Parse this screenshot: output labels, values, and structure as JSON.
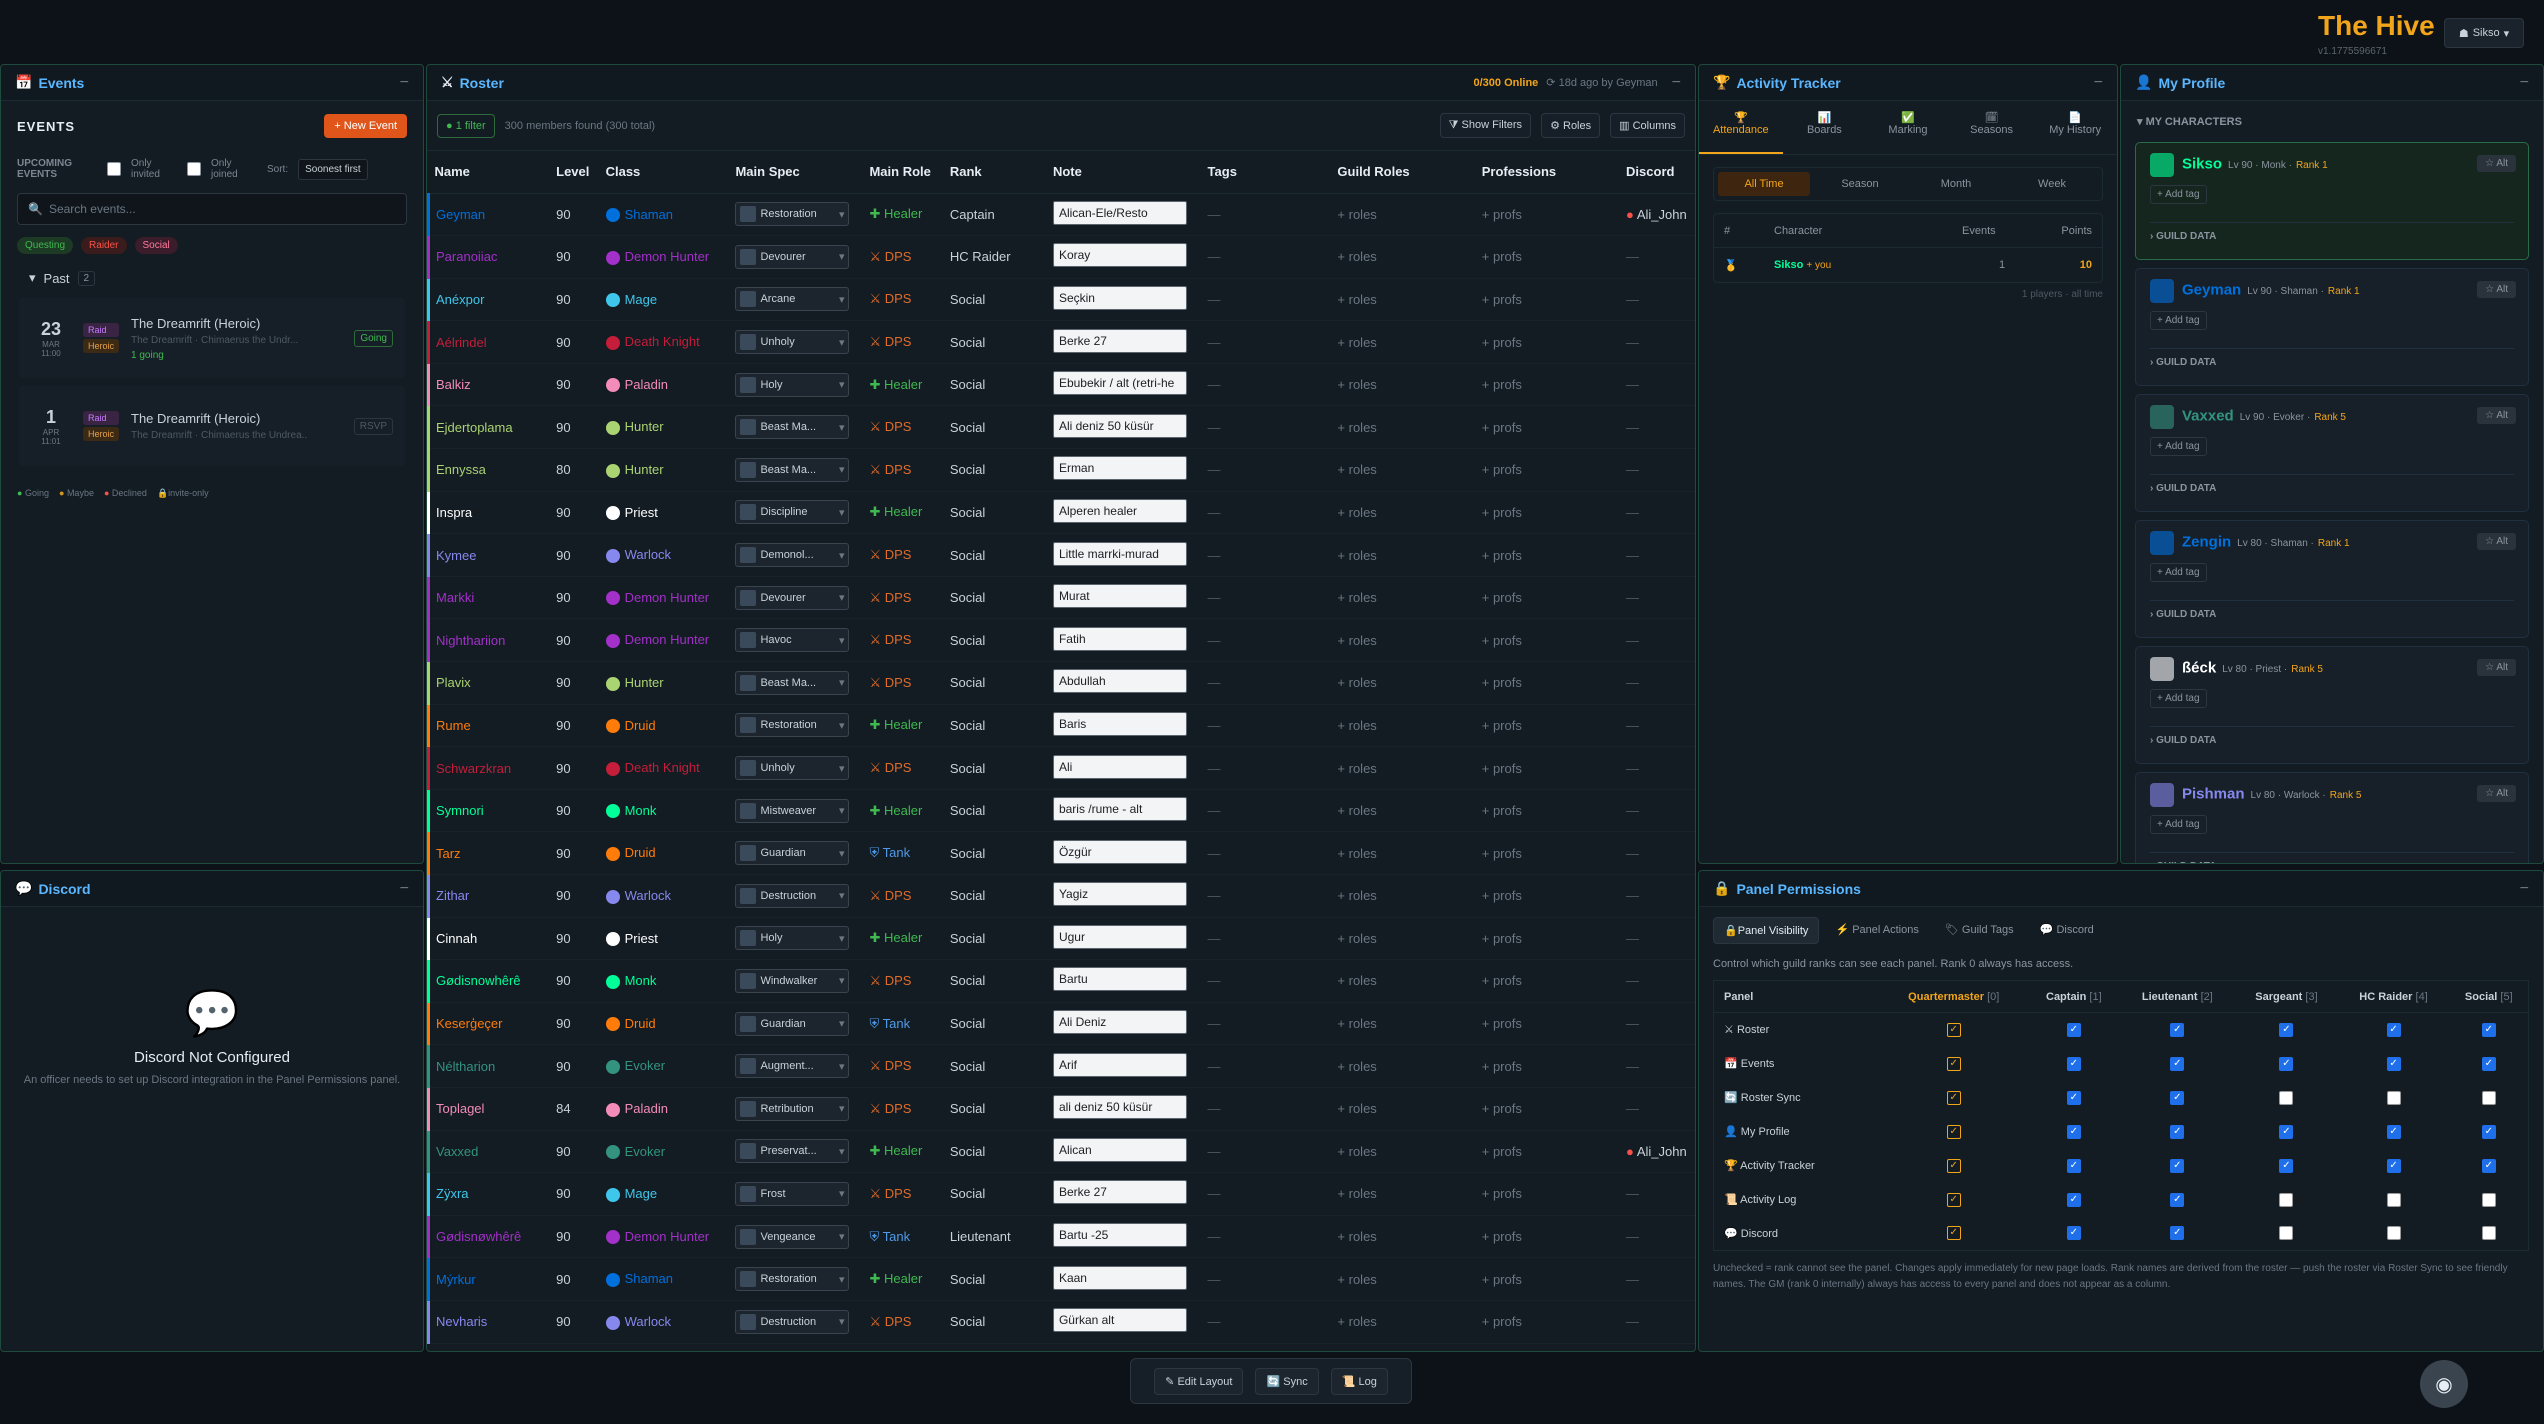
{
  "header": {
    "brand": "The Hive",
    "version": "v1.1775596671",
    "user": "Sikso"
  },
  "events": {
    "panel_title": "Events",
    "heading": "EVENTS",
    "new_btn": "+ New Event",
    "upcoming": "UPCOMING EVENTS",
    "only_invited": "Only invited",
    "only_joined": "Only joined",
    "sort_label": "Sort:",
    "sort_value": "Soonest first",
    "search_placeholder": "Search events...",
    "tags": [
      "Questing",
      "Raider",
      "Social"
    ],
    "past_label": "Past",
    "past_count": "2",
    "items": [
      {
        "day": "23",
        "month": "MAR",
        "time": "11:00",
        "type": "Raid",
        "diff": "Heroic",
        "title": "The Dreamrift (Heroic)",
        "desc": "The Dreamrift · Chimaerus the Undr...",
        "status": "Going",
        "going": "1 going"
      },
      {
        "day": "1",
        "month": "APR",
        "time": "11:01",
        "type": "Raid",
        "diff": "Heroic",
        "title": "The Dreamrift (Heroic)",
        "desc": "The Dreamrift · Chimaerus the Undrea..",
        "status": "RSVP"
      }
    ],
    "legend": [
      "Going",
      "Maybe",
      "Declined",
      "invite-only"
    ]
  },
  "discord": {
    "panel_title": "Discord",
    "title": "Discord Not Configured",
    "body": "An officer needs to set up Discord integration in the Panel Permissions panel."
  },
  "roster": {
    "panel_title": "Roster",
    "online": "0/300 Online",
    "synced": "18d ago by Geyman",
    "filter_badge": "1 filter",
    "found": "300 members found (300 total)",
    "show_filters": "Show Filters",
    "roles_btn": "Roles",
    "columns_btn": "Columns",
    "columns": [
      "Name",
      "Level",
      "Class",
      "Main Spec",
      "Main Role",
      "Rank",
      "Note",
      "Tags",
      "Guild Roles",
      "Professions",
      "Discord"
    ],
    "roles_placeholder": "+ roles",
    "profs_placeholder": "+ profs",
    "dash": "—",
    "rows": [
      {
        "name": "Geyman",
        "level": "90",
        "cls": "Shaman",
        "color": "#0070dd",
        "spec": "Restoration",
        "role": "Healer",
        "rank": "Captain",
        "note": "Alican-Ele/Resto",
        "discord": "Ali_John"
      },
      {
        "name": "Paranoiiac",
        "level": "90",
        "cls": "Demon Hunter",
        "color": "#a330c9",
        "spec": "Devourer",
        "role": "DPS",
        "rank": "HC Raider",
        "note": "Koray",
        "discord": ""
      },
      {
        "name": "Anéxpor",
        "level": "90",
        "cls": "Mage",
        "color": "#3fc7eb",
        "spec": "Arcane",
        "role": "DPS",
        "rank": "Social",
        "note": "Seçkin",
        "discord": ""
      },
      {
        "name": "Aélrindel",
        "level": "90",
        "cls": "Death Knight",
        "color": "#c41e3a",
        "spec": "Unholy",
        "role": "DPS",
        "rank": "Social",
        "note": "Berke 27",
        "discord": ""
      },
      {
        "name": "Balkiz",
        "level": "90",
        "cls": "Paladin",
        "color": "#f48cba",
        "spec": "Holy",
        "role": "Healer",
        "rank": "Social",
        "note": "Ebubekir / alt (retri-he",
        "discord": ""
      },
      {
        "name": "Ejdertoplama",
        "level": "90",
        "cls": "Hunter",
        "color": "#aad372",
        "spec": "Beast Ma...",
        "role": "DPS",
        "rank": "Social",
        "note": "Ali deniz 50 küsür",
        "discord": ""
      },
      {
        "name": "Ennyssa",
        "level": "80",
        "cls": "Hunter",
        "color": "#aad372",
        "spec": "Beast Ma...",
        "role": "DPS",
        "rank": "Social",
        "note": "Erman",
        "discord": ""
      },
      {
        "name": "Inspra",
        "level": "90",
        "cls": "Priest",
        "color": "#ffffff",
        "spec": "Discipline",
        "role": "Healer",
        "rank": "Social",
        "note": "Alperen healer",
        "discord": ""
      },
      {
        "name": "Kymee",
        "level": "90",
        "cls": "Warlock",
        "color": "#8788ee",
        "spec": "Demonol...",
        "role": "DPS",
        "rank": "Social",
        "note": "Little marrki-murad",
        "discord": ""
      },
      {
        "name": "Markki",
        "level": "90",
        "cls": "Demon Hunter",
        "color": "#a330c9",
        "spec": "Devourer",
        "role": "DPS",
        "rank": "Social",
        "note": "Murat",
        "discord": ""
      },
      {
        "name": "Nighthariion",
        "level": "90",
        "cls": "Demon Hunter",
        "color": "#a330c9",
        "spec": "Havoc",
        "role": "DPS",
        "rank": "Social",
        "note": "Fatih",
        "discord": ""
      },
      {
        "name": "Plavix",
        "level": "90",
        "cls": "Hunter",
        "color": "#aad372",
        "spec": "Beast Ma...",
        "role": "DPS",
        "rank": "Social",
        "note": "Abdullah",
        "discord": ""
      },
      {
        "name": "Rume",
        "level": "90",
        "cls": "Druid",
        "color": "#ff7c0a",
        "spec": "Restoration",
        "role": "Healer",
        "rank": "Social",
        "note": "Baris",
        "discord": ""
      },
      {
        "name": "Schwarzkran",
        "level": "90",
        "cls": "Death Knight",
        "color": "#c41e3a",
        "spec": "Unholy",
        "role": "DPS",
        "rank": "Social",
        "note": "Ali",
        "discord": ""
      },
      {
        "name": "Symnori",
        "level": "90",
        "cls": "Monk",
        "color": "#00ff98",
        "spec": "Mistweaver",
        "role": "Healer",
        "rank": "Social",
        "note": "baris /rume - alt",
        "discord": ""
      },
      {
        "name": "Tarz",
        "level": "90",
        "cls": "Druid",
        "color": "#ff7c0a",
        "spec": "Guardian",
        "role": "Tank",
        "rank": "Social",
        "note": "Özgür",
        "discord": ""
      },
      {
        "name": "Zithar",
        "level": "90",
        "cls": "Warlock",
        "color": "#8788ee",
        "spec": "Destruction",
        "role": "DPS",
        "rank": "Social",
        "note": "Yagiz",
        "discord": ""
      },
      {
        "name": "Cinnah",
        "level": "90",
        "cls": "Priest",
        "color": "#ffffff",
        "spec": "Holy",
        "role": "Healer",
        "rank": "Social",
        "note": "Ugur",
        "discord": ""
      },
      {
        "name": "Gødisnowhêrê",
        "level": "90",
        "cls": "Monk",
        "color": "#00ff98",
        "spec": "Windwalker",
        "role": "DPS",
        "rank": "Social",
        "note": "Bartu",
        "discord": ""
      },
      {
        "name": "Keserģeçer",
        "level": "90",
        "cls": "Druid",
        "color": "#ff7c0a",
        "spec": "Guardian",
        "role": "Tank",
        "rank": "Social",
        "note": "Ali Deniz",
        "discord": ""
      },
      {
        "name": "Néltharion",
        "level": "90",
        "cls": "Evoker",
        "color": "#33937f",
        "spec": "Augment...",
        "role": "DPS",
        "rank": "Social",
        "note": "Arif",
        "discord": ""
      },
      {
        "name": "Toplagel",
        "level": "84",
        "cls": "Paladin",
        "color": "#f48cba",
        "spec": "Retribution",
        "role": "DPS",
        "rank": "Social",
        "note": "ali deniz 50 küsür",
        "discord": ""
      },
      {
        "name": "Vaxxed",
        "level": "90",
        "cls": "Evoker",
        "color": "#33937f",
        "spec": "Preservat...",
        "role": "Healer",
        "rank": "Social",
        "note": "Alican",
        "discord": "Ali_John"
      },
      {
        "name": "Zÿxra",
        "level": "90",
        "cls": "Mage",
        "color": "#3fc7eb",
        "spec": "Frost",
        "role": "DPS",
        "rank": "Social",
        "note": "Berke 27",
        "discord": ""
      },
      {
        "name": "Gødisnøwhêrê",
        "level": "90",
        "cls": "Demon Hunter",
        "color": "#a330c9",
        "spec": "Vengeance",
        "role": "Tank",
        "rank": "Lieutenant",
        "note": "Bartu -25",
        "discord": ""
      },
      {
        "name": "Mýrkur",
        "level": "90",
        "cls": "Shaman",
        "color": "#0070dd",
        "spec": "Restoration",
        "role": "Healer",
        "rank": "Social",
        "note": "Kaan",
        "discord": ""
      },
      {
        "name": "Nevharis",
        "level": "90",
        "cls": "Warlock",
        "color": "#8788ee",
        "spec": "Destruction",
        "role": "DPS",
        "rank": "Social",
        "note": "Gürkan alt",
        "discord": ""
      }
    ]
  },
  "activity": {
    "panel_title": "Activity Tracker",
    "tabs": [
      "Attendance",
      "Boards",
      "Marking",
      "Seasons",
      "My History"
    ],
    "periods": [
      "All Time",
      "Season",
      "Month",
      "Week"
    ],
    "cols": [
      "#",
      "Character",
      "Events",
      "Points"
    ],
    "row": {
      "name": "Sikso",
      "you": "+ you",
      "events": "1",
      "points": "10"
    },
    "footer": "1 players · all time"
  },
  "profile": {
    "panel_title": "My Profile",
    "section": "MY CHARACTERS",
    "add_tag": "+ Add tag",
    "guild_data": "GUILD DATA",
    "alt": "Alt",
    "chars": [
      {
        "name": "Sikso",
        "meta": "Lv 90 · Monk ·",
        "rank": "Rank 1",
        "color": "#00ff98"
      },
      {
        "name": "Geyman",
        "meta": "Lv 90 · Shaman ·",
        "rank": "Rank 1",
        "color": "#0070dd"
      },
      {
        "name": "Vaxxed",
        "meta": "Lv 90 · Evoker ·",
        "rank": "Rank 5",
        "color": "#33937f"
      },
      {
        "name": "Zengin",
        "meta": "Lv 80 · Shaman ·",
        "rank": "Rank 1",
        "color": "#0070dd"
      },
      {
        "name": "ßéck",
        "meta": "Lv 80 · Priest ·",
        "rank": "Rank 5",
        "color": "#ffffff"
      },
      {
        "name": "Pishman",
        "meta": "Lv 80 · Warlock ·",
        "rank": "Rank 5",
        "color": "#8788ee"
      }
    ]
  },
  "perms": {
    "panel_title": "Panel Permissions",
    "tabs": [
      "Panel Visibility",
      "Panel Actions",
      "Guild Tags",
      "Discord"
    ],
    "desc": "Control which guild ranks can see each panel. Rank 0 always has access.",
    "headers": [
      {
        "name": "Panel",
        "n": ""
      },
      {
        "name": "Quartermaster",
        "n": "[0]"
      },
      {
        "name": "Captain",
        "n": "[1]"
      },
      {
        "name": "Lieutenant",
        "n": "[2]"
      },
      {
        "name": "Sargeant",
        "n": "[3]"
      },
      {
        "name": "HC Raider",
        "n": "[4]"
      },
      {
        "name": "Social",
        "n": "[5]"
      }
    ],
    "rows": [
      {
        "panel": "Roster",
        "v": [
          1,
          1,
          1,
          1,
          1
        ]
      },
      {
        "panel": "Events",
        "v": [
          1,
          1,
          1,
          1,
          1
        ]
      },
      {
        "panel": "Roster Sync",
        "v": [
          1,
          1,
          0,
          0,
          0
        ]
      },
      {
        "panel": "My Profile",
        "v": [
          1,
          1,
          1,
          1,
          1
        ]
      },
      {
        "panel": "Activity Tracker",
        "v": [
          1,
          1,
          1,
          1,
          1
        ]
      },
      {
        "panel": "Activity Log",
        "v": [
          1,
          1,
          0,
          0,
          0
        ]
      },
      {
        "panel": "Discord",
        "v": [
          1,
          1,
          0,
          0,
          0
        ]
      }
    ],
    "footer": "Unchecked = rank cannot see the panel. Changes apply immediately for new page loads. Rank names are derived from the roster — push the roster via Roster Sync to see friendly names. The GM (rank 0 internally) always has access to every panel and does not appear as a column."
  },
  "bottombar": {
    "edit": "Edit Layout",
    "sync": "Sync",
    "log": "Log"
  }
}
